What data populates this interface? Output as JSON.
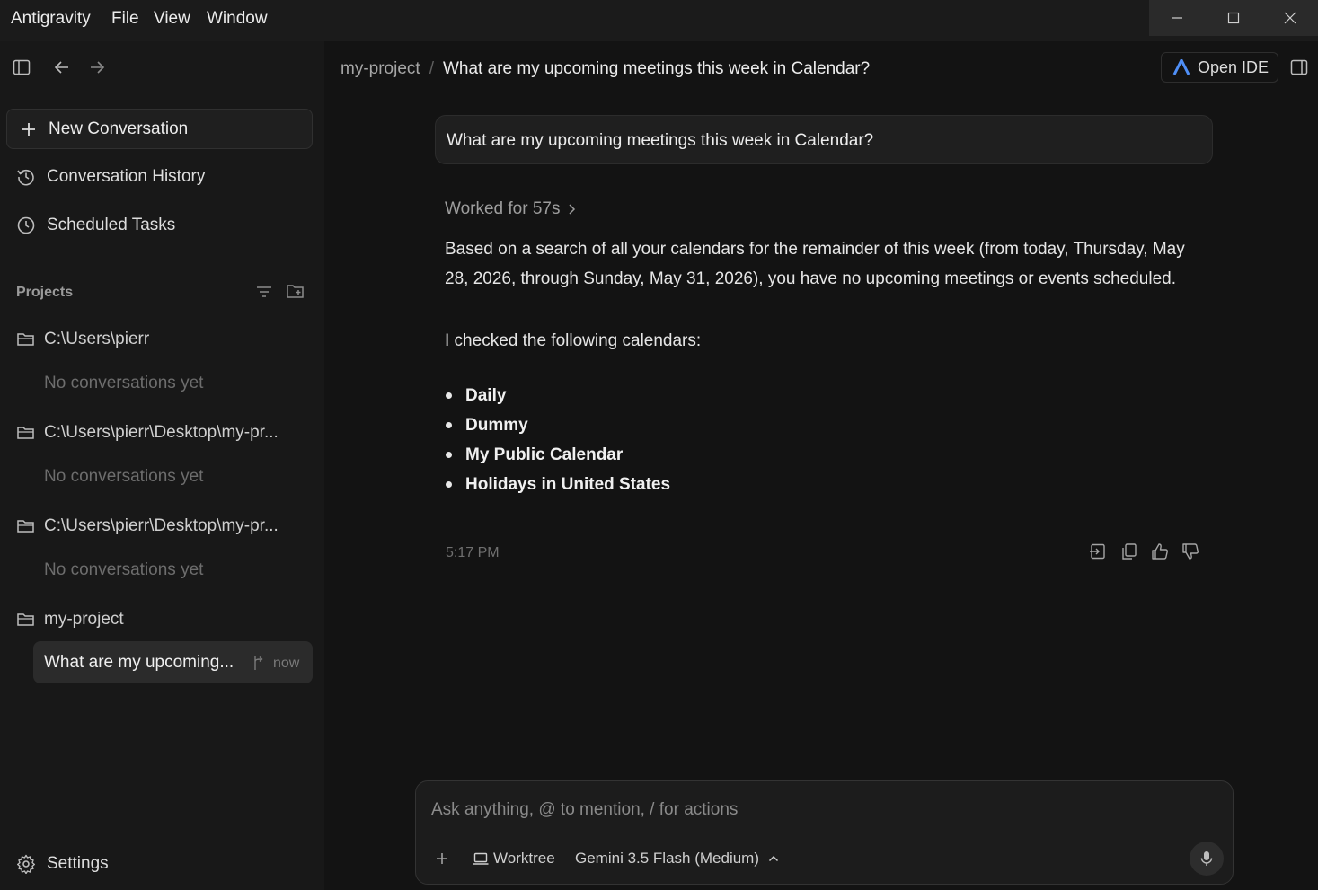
{
  "menubar": {
    "app_name": "Antigravity",
    "file": "File",
    "view": "View",
    "window": "Window"
  },
  "sidebar": {
    "new_conversation": "New Conversation",
    "conversation_history": "Conversation History",
    "scheduled_tasks": "Scheduled Tasks",
    "projects_label": "Projects",
    "projects": [
      {
        "name": "C:\\Users\\pierr",
        "empty_text": "No conversations yet"
      },
      {
        "name": "C:\\Users\\pierr\\Desktop\\my-pr...",
        "empty_text": "No conversations yet"
      },
      {
        "name": "C:\\Users\\pierr\\Desktop\\my-pr...",
        "empty_text": "No conversations yet"
      },
      {
        "name": "my-project"
      }
    ],
    "active_conversation": {
      "title": "What are my upcoming...",
      "time": "now"
    },
    "settings": "Settings"
  },
  "header": {
    "project": "my-project",
    "separator": "/",
    "title": "What are my upcoming meetings this week in Calendar?",
    "open_ide": "Open IDE"
  },
  "conversation": {
    "user_message": "What are my upcoming meetings this week in Calendar?",
    "worked_for": "Worked for 57s",
    "answer_paragraph": "Based on a search of all your calendars for the remainder of this week (from today, Thursday, May 28, 2026, through Sunday, May 31, 2026), you have no upcoming meetings or events scheduled.",
    "checked_intro": "I checked the following calendars:",
    "calendars": [
      "Daily",
      "Dummy",
      "My Public Calendar",
      "Holidays in United States"
    ],
    "timestamp": "5:17 PM"
  },
  "composer": {
    "placeholder": "Ask anything, @ to mention, / for actions",
    "worktree": "Worktree",
    "model": "Gemini 3.5 Flash (Medium)"
  },
  "colors": {
    "background": "#131313",
    "sidebar": "#181818",
    "ide_logo": "#4f8ff7"
  }
}
